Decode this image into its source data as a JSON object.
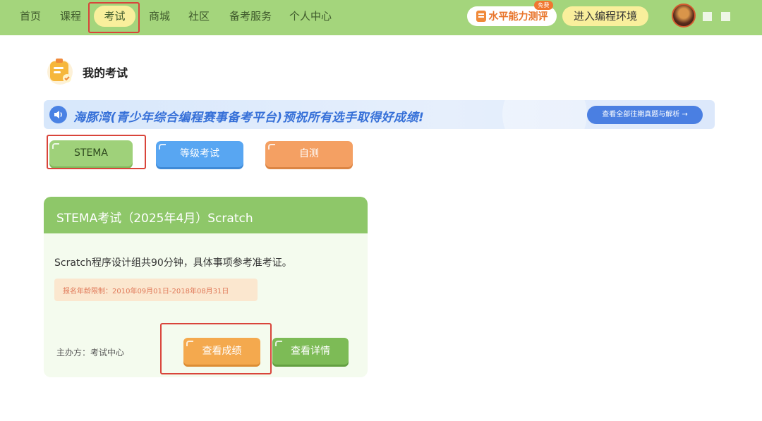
{
  "nav": {
    "items": [
      "首页",
      "课程",
      "考试",
      "商城",
      "社区",
      "备考服务",
      "个人中心"
    ],
    "active_index": 2,
    "eval_label": "水平能力测评",
    "free_badge": "免费",
    "env_label": "进入编程环境"
  },
  "page": {
    "title": "我的考试"
  },
  "banner": {
    "text": "海豚湾(青少年综合编程赛事备考平台)预祝所有选手取得好成绩!",
    "button": "查看全部往期真题与解析 →"
  },
  "tabs": [
    "STEMA",
    "等级考试",
    "自测"
  ],
  "exam": {
    "title": "STEMA考试（2025年4月）Scratch",
    "description": "Scratch程序设计组共90分钟，具体事项参考准考证。",
    "age_limit": "报名年龄限制：2010年09月01日-2018年08月31日",
    "organizer": "主办方：考试中心",
    "score_button": "查看成绩",
    "detail_button": "查看详情"
  },
  "colors": {
    "nav_bg": "#a4d57c",
    "active_pill": "#f9ef9c",
    "card_header": "#8ec769",
    "score_button": "#f4a94e",
    "detail_button": "#7dbb56",
    "highlight": "#d9443a"
  }
}
